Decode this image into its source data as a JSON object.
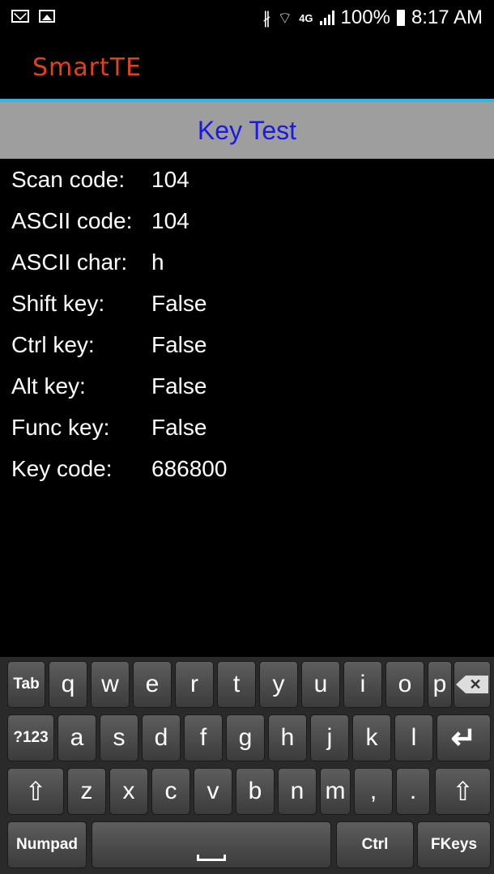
{
  "status_bar": {
    "battery_percent": "100%",
    "time": "8:17 AM",
    "network_label": "4G",
    "icons": [
      "mail-icon",
      "image-icon",
      "bluetooth-icon",
      "wifi-icon",
      "network-4g-icon",
      "signal-icon",
      "battery-icon"
    ]
  },
  "app": {
    "title": "SmartTE",
    "title_color": "#e0421a",
    "accent_line_color": "#33b5e5"
  },
  "header": {
    "title": "Key Test",
    "title_color": "#1a1ae6",
    "background": "#9e9e9e"
  },
  "info": [
    {
      "label": "Scan code:",
      "value": "104"
    },
    {
      "label": "ASCII code:",
      "value": "104"
    },
    {
      "label": "ASCII char:",
      "value": "h"
    },
    {
      "label": "Shift key:",
      "value": "False"
    },
    {
      "label": "Ctrl key:",
      "value": "False"
    },
    {
      "label": "Alt key:",
      "value": "False"
    },
    {
      "label": "Func key:",
      "value": "False"
    },
    {
      "label": "Key code:",
      "value": "686800"
    }
  ],
  "keyboard": {
    "row1": [
      "Tab",
      "q",
      "w",
      "e",
      "r",
      "t",
      "y",
      "u",
      "i",
      "o",
      "p",
      "backspace"
    ],
    "row2": [
      "?123",
      "a",
      "s",
      "d",
      "f",
      "g",
      "h",
      "j",
      "k",
      "l",
      "enter"
    ],
    "row3": [
      "shift",
      "z",
      "x",
      "c",
      "v",
      "b",
      "n",
      "m",
      ",",
      ".",
      "shift"
    ],
    "row4": [
      "Numpad",
      "space",
      "Ctrl",
      "FKeys"
    ]
  }
}
